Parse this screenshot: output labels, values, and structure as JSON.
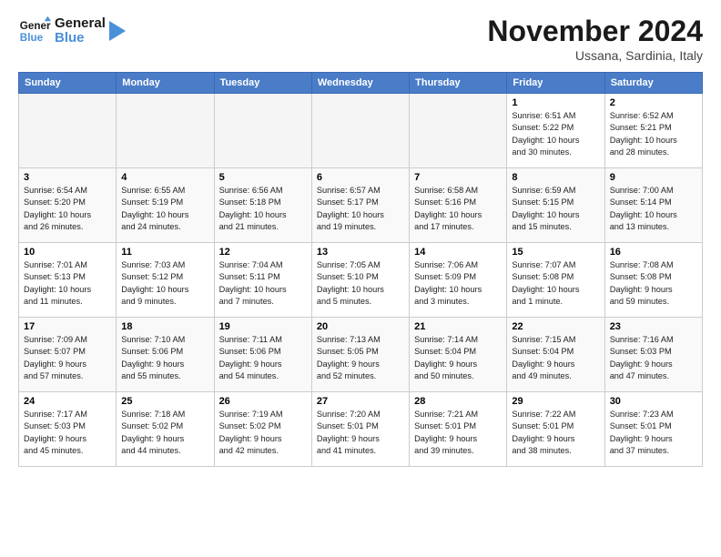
{
  "header": {
    "logo_line1": "General",
    "logo_line2": "Blue",
    "month": "November 2024",
    "location": "Ussana, Sardinia, Italy"
  },
  "weekdays": [
    "Sunday",
    "Monday",
    "Tuesday",
    "Wednesday",
    "Thursday",
    "Friday",
    "Saturday"
  ],
  "weeks": [
    [
      {
        "day": "",
        "info": ""
      },
      {
        "day": "",
        "info": ""
      },
      {
        "day": "",
        "info": ""
      },
      {
        "day": "",
        "info": ""
      },
      {
        "day": "",
        "info": ""
      },
      {
        "day": "1",
        "info": "Sunrise: 6:51 AM\nSunset: 5:22 PM\nDaylight: 10 hours\nand 30 minutes."
      },
      {
        "day": "2",
        "info": "Sunrise: 6:52 AM\nSunset: 5:21 PM\nDaylight: 10 hours\nand 28 minutes."
      }
    ],
    [
      {
        "day": "3",
        "info": "Sunrise: 6:54 AM\nSunset: 5:20 PM\nDaylight: 10 hours\nand 26 minutes."
      },
      {
        "day": "4",
        "info": "Sunrise: 6:55 AM\nSunset: 5:19 PM\nDaylight: 10 hours\nand 24 minutes."
      },
      {
        "day": "5",
        "info": "Sunrise: 6:56 AM\nSunset: 5:18 PM\nDaylight: 10 hours\nand 21 minutes."
      },
      {
        "day": "6",
        "info": "Sunrise: 6:57 AM\nSunset: 5:17 PM\nDaylight: 10 hours\nand 19 minutes."
      },
      {
        "day": "7",
        "info": "Sunrise: 6:58 AM\nSunset: 5:16 PM\nDaylight: 10 hours\nand 17 minutes."
      },
      {
        "day": "8",
        "info": "Sunrise: 6:59 AM\nSunset: 5:15 PM\nDaylight: 10 hours\nand 15 minutes."
      },
      {
        "day": "9",
        "info": "Sunrise: 7:00 AM\nSunset: 5:14 PM\nDaylight: 10 hours\nand 13 minutes."
      }
    ],
    [
      {
        "day": "10",
        "info": "Sunrise: 7:01 AM\nSunset: 5:13 PM\nDaylight: 10 hours\nand 11 minutes."
      },
      {
        "day": "11",
        "info": "Sunrise: 7:03 AM\nSunset: 5:12 PM\nDaylight: 10 hours\nand 9 minutes."
      },
      {
        "day": "12",
        "info": "Sunrise: 7:04 AM\nSunset: 5:11 PM\nDaylight: 10 hours\nand 7 minutes."
      },
      {
        "day": "13",
        "info": "Sunrise: 7:05 AM\nSunset: 5:10 PM\nDaylight: 10 hours\nand 5 minutes."
      },
      {
        "day": "14",
        "info": "Sunrise: 7:06 AM\nSunset: 5:09 PM\nDaylight: 10 hours\nand 3 minutes."
      },
      {
        "day": "15",
        "info": "Sunrise: 7:07 AM\nSunset: 5:08 PM\nDaylight: 10 hours\nand 1 minute."
      },
      {
        "day": "16",
        "info": "Sunrise: 7:08 AM\nSunset: 5:08 PM\nDaylight: 9 hours\nand 59 minutes."
      }
    ],
    [
      {
        "day": "17",
        "info": "Sunrise: 7:09 AM\nSunset: 5:07 PM\nDaylight: 9 hours\nand 57 minutes."
      },
      {
        "day": "18",
        "info": "Sunrise: 7:10 AM\nSunset: 5:06 PM\nDaylight: 9 hours\nand 55 minutes."
      },
      {
        "day": "19",
        "info": "Sunrise: 7:11 AM\nSunset: 5:06 PM\nDaylight: 9 hours\nand 54 minutes."
      },
      {
        "day": "20",
        "info": "Sunrise: 7:13 AM\nSunset: 5:05 PM\nDaylight: 9 hours\nand 52 minutes."
      },
      {
        "day": "21",
        "info": "Sunrise: 7:14 AM\nSunset: 5:04 PM\nDaylight: 9 hours\nand 50 minutes."
      },
      {
        "day": "22",
        "info": "Sunrise: 7:15 AM\nSunset: 5:04 PM\nDaylight: 9 hours\nand 49 minutes."
      },
      {
        "day": "23",
        "info": "Sunrise: 7:16 AM\nSunset: 5:03 PM\nDaylight: 9 hours\nand 47 minutes."
      }
    ],
    [
      {
        "day": "24",
        "info": "Sunrise: 7:17 AM\nSunset: 5:03 PM\nDaylight: 9 hours\nand 45 minutes."
      },
      {
        "day": "25",
        "info": "Sunrise: 7:18 AM\nSunset: 5:02 PM\nDaylight: 9 hours\nand 44 minutes."
      },
      {
        "day": "26",
        "info": "Sunrise: 7:19 AM\nSunset: 5:02 PM\nDaylight: 9 hours\nand 42 minutes."
      },
      {
        "day": "27",
        "info": "Sunrise: 7:20 AM\nSunset: 5:01 PM\nDaylight: 9 hours\nand 41 minutes."
      },
      {
        "day": "28",
        "info": "Sunrise: 7:21 AM\nSunset: 5:01 PM\nDaylight: 9 hours\nand 39 minutes."
      },
      {
        "day": "29",
        "info": "Sunrise: 7:22 AM\nSunset: 5:01 PM\nDaylight: 9 hours\nand 38 minutes."
      },
      {
        "day": "30",
        "info": "Sunrise: 7:23 AM\nSunset: 5:01 PM\nDaylight: 9 hours\nand 37 minutes."
      }
    ]
  ]
}
